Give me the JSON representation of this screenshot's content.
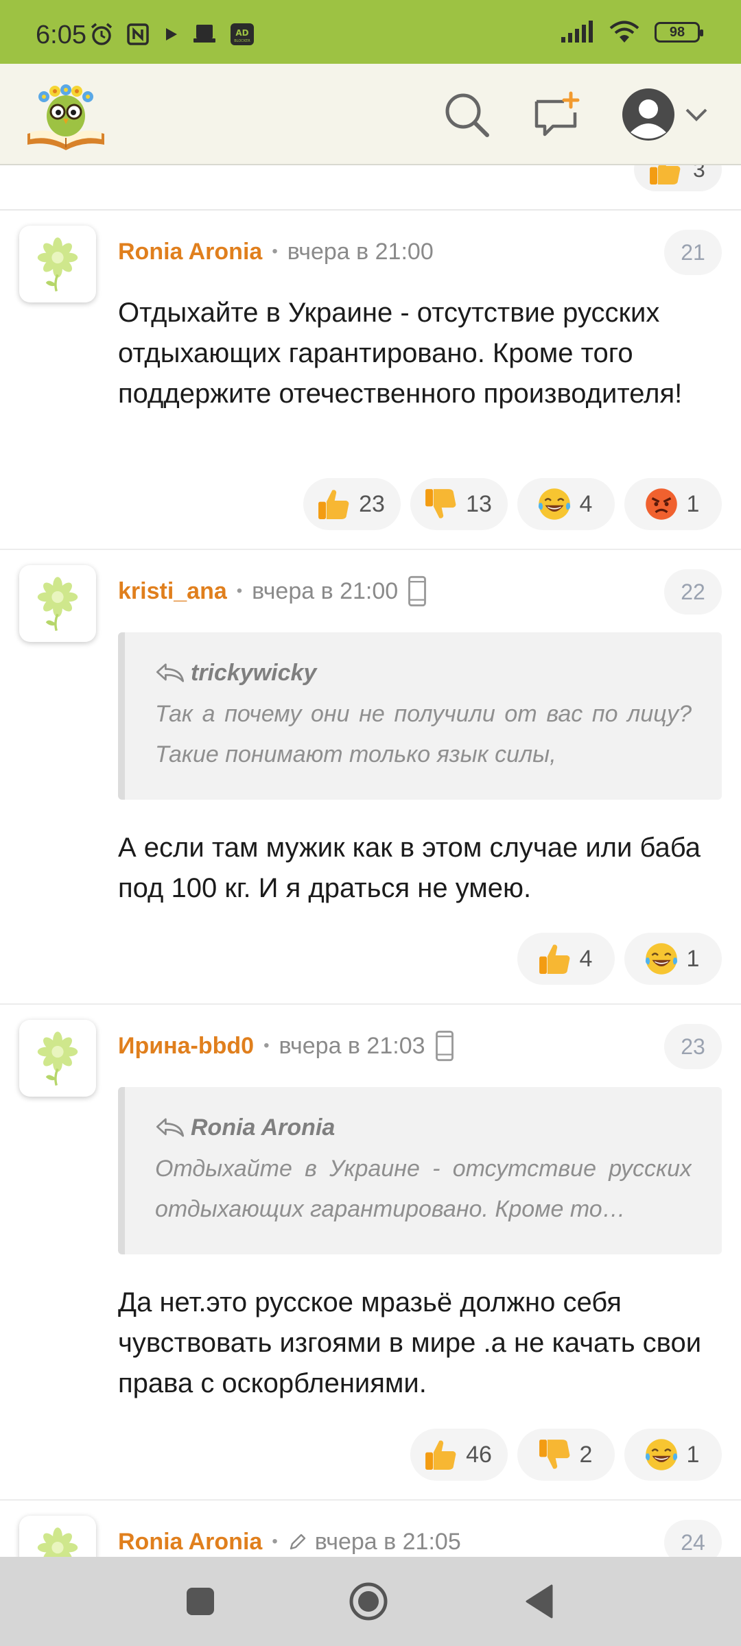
{
  "status_bar": {
    "time": "6:05",
    "battery": "98",
    "left_icons": [
      "alarm-icon",
      "nfc-icon",
      "play-icon",
      "notification-icon",
      "adblocker-icon"
    ],
    "right_icons": [
      "signal-icon",
      "wifi-icon",
      "battery-icon"
    ]
  },
  "header": {
    "logo": "owl-with-book-logo",
    "buttons": [
      "search-icon",
      "new-post-icon",
      "user-avatar-icon",
      "chevron-down-icon"
    ]
  },
  "previous_comment": {
    "likes": "3"
  },
  "comments": [
    {
      "author": "Ronia Aronia",
      "time": "вчера в 21:00",
      "number": "21",
      "text": "Отдыхайте в Украине - отсутствие русских отдыхающих гарантировано. Кроме того поддержите отечественного производителя!",
      "reactions": [
        {
          "type": "thumbs-up",
          "count": "23"
        },
        {
          "type": "thumbs-down",
          "count": "13"
        },
        {
          "type": "laughing",
          "count": "4"
        },
        {
          "type": "angry",
          "count": "1"
        }
      ]
    },
    {
      "author": "kristi_ana",
      "time": "вчера в 21:00",
      "number": "22",
      "quote": {
        "author": "trickywicky",
        "text": "Так а почему они не получили от вас по лицу? Такие понимают только язык силы,"
      },
      "text": "А если там мужик как в этом случае или баба под 100 кг. И я драться не умею.",
      "reactions": [
        {
          "type": "thumbs-up",
          "count": "4"
        },
        {
          "type": "laughing",
          "count": "1"
        }
      ]
    },
    {
      "author": "Ирина-bbd0",
      "time": "вчера в 21:03",
      "number": "23",
      "quote": {
        "author": "Ronia Aronia",
        "text": "Отдыхайте в Украине - отсутствие русских отдыхающих гарантировано. Кроме то…"
      },
      "text": "Да нет.это русское мразьё должно себя чувствовать изгоями в мире .а не качать свои права с оскорблениями.",
      "reactions": [
        {
          "type": "thumbs-up",
          "count": "46"
        },
        {
          "type": "thumbs-down",
          "count": "2"
        },
        {
          "type": "laughing",
          "count": "1"
        }
      ]
    },
    {
      "author": "Ronia Aronia",
      "time": "вчера в 21:05",
      "number": "24"
    }
  ],
  "nav": [
    "recents-square-icon",
    "home-circle-icon",
    "back-triangle-icon"
  ],
  "colors": {
    "status_bar": "#9dc243",
    "header_bg": "#f5f4ea",
    "author": "#e07f1d",
    "nav_bg": "#d6d6d6"
  }
}
